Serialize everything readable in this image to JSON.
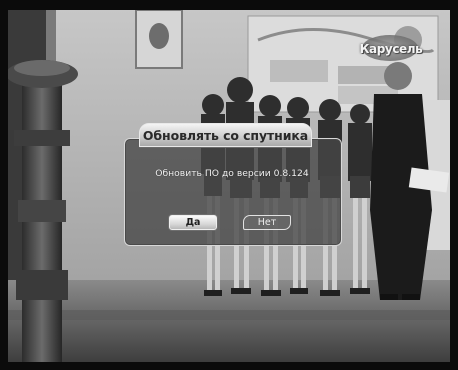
{
  "tv": {
    "channel_logo_text": "Карусель"
  },
  "dialog": {
    "title": "Обновлять со спутника",
    "message": "Обновить ПО до версии 0.8.124",
    "buttons": {
      "yes_label": "Да",
      "no_label": "Нет"
    },
    "selected_button": "yes"
  },
  "colors": {
    "dialog_background": "#464646",
    "dialog_border": "#d8d8d8",
    "title_tab": "#cfcfcf",
    "text": "#f2f2f2"
  }
}
